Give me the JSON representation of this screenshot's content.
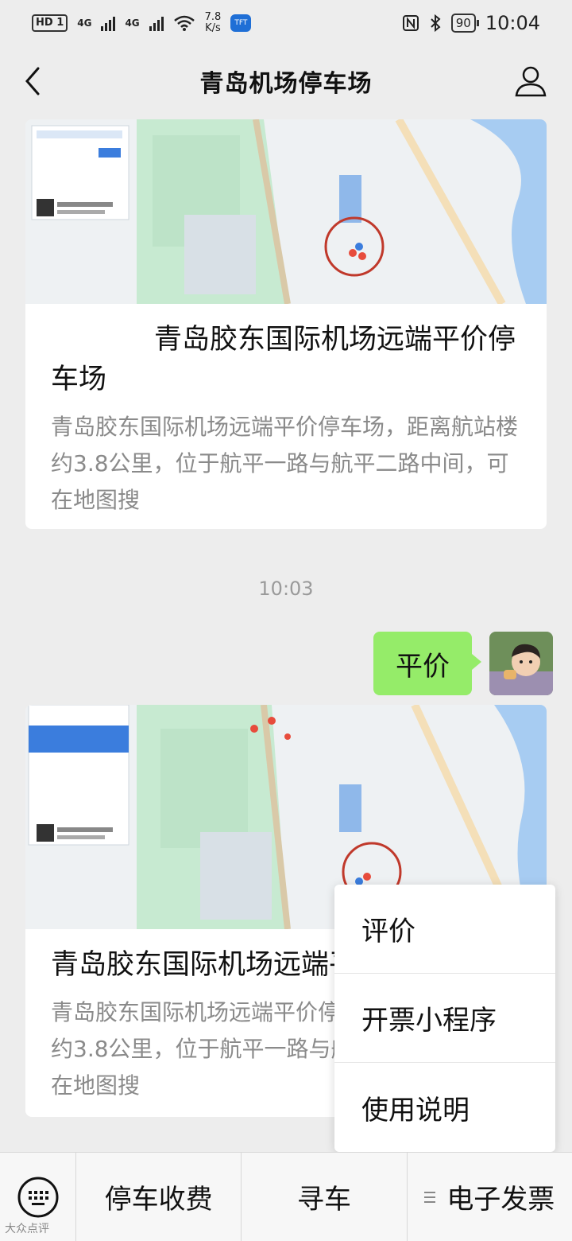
{
  "status_bar": {
    "hd": "HD",
    "sim": "1",
    "net1": "4G",
    "net2": "4G",
    "speed_value": "7.8",
    "speed_unit": "K/s",
    "app_badge": "TFT",
    "battery": "90",
    "time": "10:04"
  },
  "header": {
    "title": "青岛机场停车场"
  },
  "messages": {
    "card1": {
      "title": "青岛胶东国际机场远端平价停车场",
      "description": "青岛胶东国际机场远端平价停车场，距离航站楼约3.8公里，位于航平一路与航平二路中间，可在地图搜"
    },
    "timestamp": "10:03",
    "outgoing": "平价",
    "card2": {
      "title": "青岛胶东国际机场远端平价停车场",
      "description": "青岛胶东国际机场远端平价停车场，距离航站楼约3.8公里，位于航平一路与航平二路中间，可在地图搜"
    }
  },
  "popup_menu": {
    "items": [
      "评价",
      "开票小程序",
      "使用说明"
    ]
  },
  "bottom_menu": {
    "items": [
      "停车收费",
      "寻车",
      "电子发票"
    ]
  },
  "watermark": "大众点评"
}
